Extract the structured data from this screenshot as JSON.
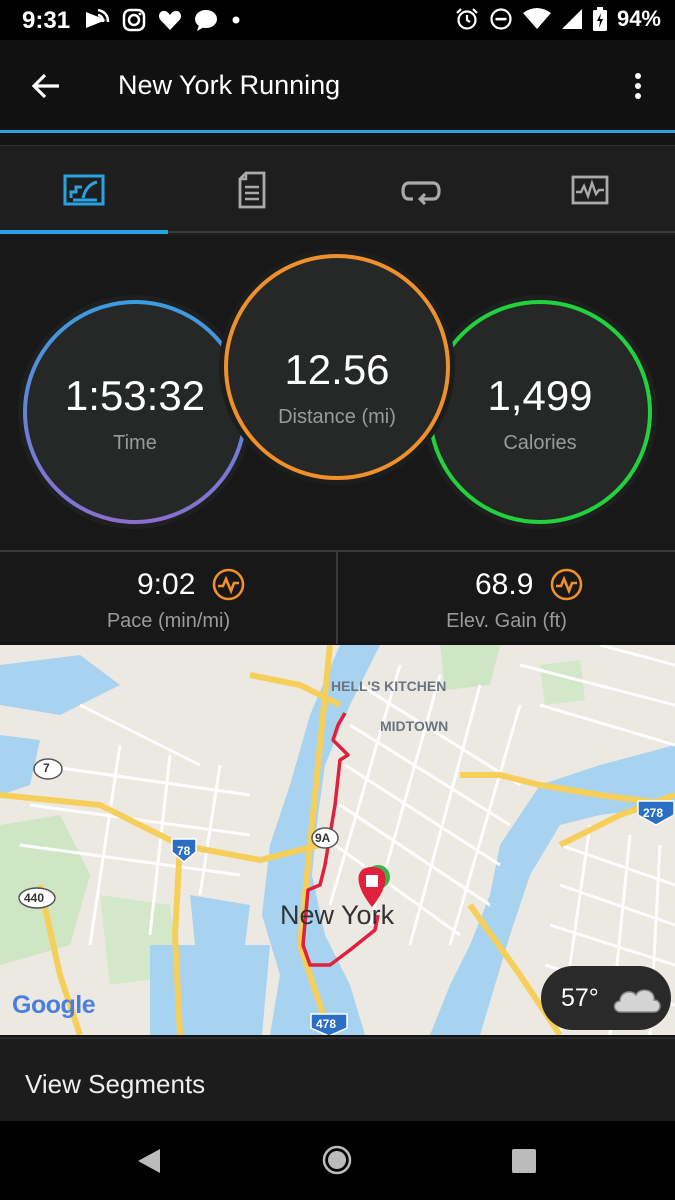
{
  "status_bar": {
    "time": "9:31",
    "battery": "94%"
  },
  "app_bar": {
    "title": "New York Running"
  },
  "tabs": [
    "overview-icon",
    "details-icon",
    "laps-icon",
    "charts-icon"
  ],
  "stats": {
    "time": {
      "value": "1:53:32",
      "label": "Time"
    },
    "distance": {
      "value": "12.56",
      "label": "Distance (mi)"
    },
    "calories": {
      "value": "1,499",
      "label": "Calories"
    }
  },
  "sub_stats": {
    "pace": {
      "value": "9:02",
      "label": "Pace (min/mi)"
    },
    "elevation": {
      "value": "68.9",
      "label": "Elev. Gain (ft)"
    }
  },
  "map": {
    "labels": {
      "hells_kitchen": "HELL'S KITCHEN",
      "midtown": "MIDTOWN",
      "city": "New York",
      "route_7": "7",
      "route_9a": "9A",
      "route_78": "78",
      "route_440": "440",
      "route_278": "278",
      "route_478": "478",
      "attribution": "Google"
    }
  },
  "weather": {
    "temp": "57°",
    "icon": "cloud-icon"
  },
  "footer": {
    "view_segments": "View Segments"
  },
  "colors": {
    "accent": "#29a3e0",
    "distance_ring": "#f0902a",
    "calories_ring": "#22d23c",
    "time_ring_top": "#3b9ce0",
    "time_ring_bottom": "#8a6fd0",
    "route": "#e0203c"
  }
}
